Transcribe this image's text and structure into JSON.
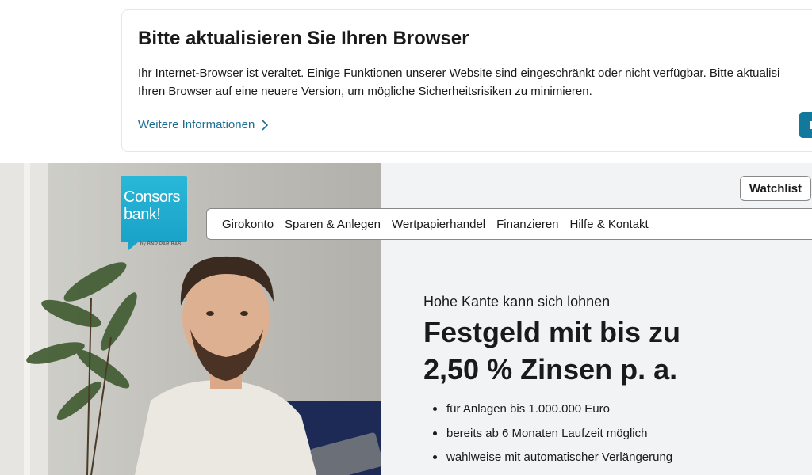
{
  "banner": {
    "title": "Bitte aktualisieren Sie Ihren Browser",
    "text_line1": "Ihr Internet-Browser ist veraltet. Einige Funktionen unserer Website sind eingeschränkt oder nicht verfügbar. Bitte aktualisi",
    "text_line2": "Ihren Browser auf eine neuere Version, um mögliche Sicherheitsrisiken zu minimieren.",
    "link_label": "Weitere Informationen",
    "button_label": "I"
  },
  "logo": {
    "text": "Consors\nbank!",
    "sub": "by BNP PARIBAS"
  },
  "header": {
    "watchlist_label": "Watchlist"
  },
  "nav": {
    "items": [
      {
        "label": "Girokonto"
      },
      {
        "label": "Sparen & Anlegen"
      },
      {
        "label": "Wertpapierhandel"
      },
      {
        "label": "Finanzieren"
      },
      {
        "label": "Hilfe & Kontakt"
      }
    ]
  },
  "hero": {
    "kicker": "Hohe Kante kann sich lohnen",
    "headline_line1": "Festgeld mit bis zu",
    "headline_line2": "2,50 % Zinsen p. a.",
    "bullets": [
      "für Anlagen bis 1.000.000 Euro",
      "bereits ab 6 Monaten Laufzeit möglich",
      "wahlweise mit automatischer Verlängerung"
    ]
  },
  "colors": {
    "accent": "#12789c",
    "link": "#1c6e93",
    "logo": "#1aa2c8",
    "hero_bg": "#f2f3f5"
  }
}
